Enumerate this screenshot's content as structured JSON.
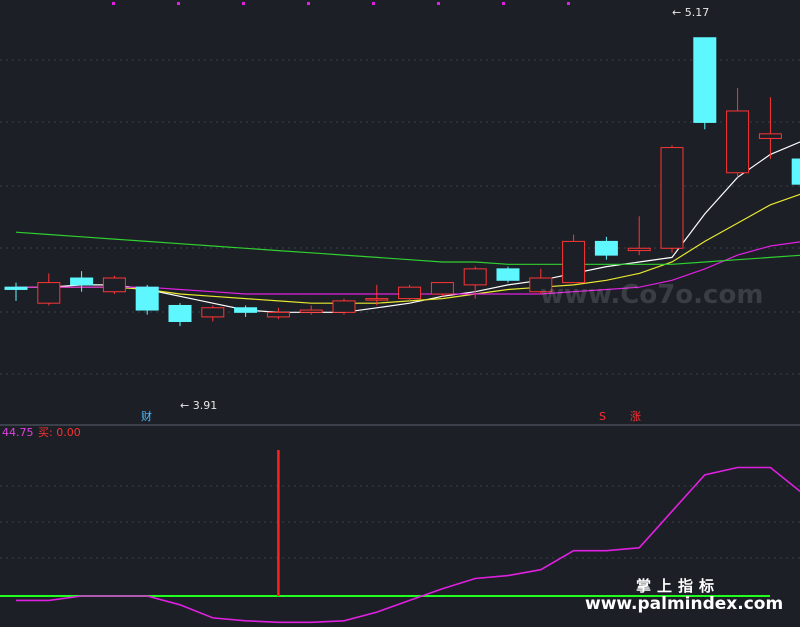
{
  "chart_data": [
    {
      "type": "candlestick",
      "price_range": [
        3.6,
        5.3
      ],
      "candles": [
        {
          "o": 4.08,
          "h": 4.1,
          "l": 4.02,
          "c": 4.07
        },
        {
          "o": 4.01,
          "h": 4.14,
          "l": 4.0,
          "c": 4.1
        },
        {
          "o": 4.12,
          "h": 4.15,
          "l": 4.06,
          "c": 4.09
        },
        {
          "o": 4.06,
          "h": 4.13,
          "l": 4.05,
          "c": 4.12
        },
        {
          "o": 4.08,
          "h": 4.09,
          "l": 3.96,
          "c": 3.98
        },
        {
          "o": 4.0,
          "h": 4.01,
          "l": 3.91,
          "c": 3.93
        },
        {
          "o": 3.95,
          "h": 4.0,
          "l": 3.93,
          "c": 3.99
        },
        {
          "o": 3.99,
          "h": 4.0,
          "l": 3.95,
          "c": 3.97
        },
        {
          "o": 3.95,
          "h": 3.99,
          "l": 3.94,
          "c": 3.97
        },
        {
          "o": 3.97,
          "h": 4.0,
          "l": 3.96,
          "c": 3.98
        },
        {
          "o": 3.97,
          "h": 4.03,
          "l": 3.96,
          "c": 4.02
        },
        {
          "o": 4.03,
          "h": 4.09,
          "l": 4.0,
          "c": 4.03
        },
        {
          "o": 4.03,
          "h": 4.09,
          "l": 4.02,
          "c": 4.08
        },
        {
          "o": 4.05,
          "h": 4.1,
          "l": 4.04,
          "c": 4.1
        },
        {
          "o": 4.09,
          "h": 4.17,
          "l": 4.03,
          "c": 4.16
        },
        {
          "o": 4.16,
          "h": 4.17,
          "l": 4.1,
          "c": 4.11
        },
        {
          "o": 4.06,
          "h": 4.16,
          "l": 4.05,
          "c": 4.12
        },
        {
          "o": 4.1,
          "h": 4.31,
          "l": 4.1,
          "c": 4.28
        },
        {
          "o": 4.28,
          "h": 4.3,
          "l": 4.2,
          "c": 4.22
        },
        {
          "o": 4.24,
          "h": 4.39,
          "l": 4.22,
          "c": 4.25
        },
        {
          "o": 4.25,
          "h": 4.7,
          "l": 4.23,
          "c": 4.69
        },
        {
          "o": 5.17,
          "h": 5.17,
          "l": 4.77,
          "c": 4.8
        },
        {
          "o": 4.58,
          "h": 4.95,
          "l": 4.56,
          "c": 4.85
        },
        {
          "o": 4.73,
          "h": 4.91,
          "l": 4.64,
          "c": 4.75
        },
        {
          "o": 4.64,
          "h": 4.67,
          "l": 4.52,
          "c": 4.53
        }
      ],
      "ma_lines": [
        {
          "name": "MA-white",
          "color": "#ffffff",
          "values": [
            4.08,
            4.08,
            4.09,
            4.09,
            4.07,
            4.04,
            4.01,
            3.98,
            3.97,
            3.97,
            3.97,
            3.99,
            4.01,
            4.04,
            4.06,
            4.09,
            4.11,
            4.14,
            4.17,
            4.19,
            4.21,
            4.4,
            4.56,
            4.66,
            4.72
          ]
        },
        {
          "name": "MA-yellow",
          "color": "#e8e830",
          "values": [
            4.08,
            4.08,
            4.08,
            4.08,
            4.07,
            4.05,
            4.04,
            4.03,
            4.02,
            4.01,
            4.01,
            4.01,
            4.02,
            4.03,
            4.05,
            4.07,
            4.08,
            4.09,
            4.11,
            4.14,
            4.19,
            4.28,
            4.36,
            4.44,
            4.49
          ]
        },
        {
          "name": "MA-magenta",
          "color": "#e020e0",
          "values": [
            4.08,
            4.08,
            4.08,
            4.08,
            4.08,
            4.07,
            4.06,
            4.05,
            4.05,
            4.05,
            4.05,
            4.05,
            4.05,
            4.05,
            4.05,
            4.05,
            4.05,
            4.06,
            4.07,
            4.08,
            4.11,
            4.16,
            4.22,
            4.26,
            4.28
          ]
        },
        {
          "name": "MA-green",
          "color": "#30d030",
          "values": [
            4.32,
            4.31,
            4.3,
            4.29,
            4.28,
            4.27,
            4.26,
            4.25,
            4.24,
            4.23,
            4.22,
            4.21,
            4.2,
            4.19,
            4.19,
            4.18,
            4.18,
            4.18,
            4.18,
            4.18,
            4.18,
            4.19,
            4.2,
            4.21,
            4.22
          ]
        }
      ],
      "high_label": "5.17",
      "low_label": "3.91",
      "markers": {
        "cai": "财",
        "s": "S",
        "zhang": "涨"
      }
    },
    {
      "type": "line",
      "indicator_value": "44.75",
      "buy_label": "买: 0.00",
      "y_range": [
        0,
        100
      ],
      "baseline": 0,
      "spike_index": 8,
      "spike_value": 100,
      "values": [
        -3,
        -3,
        0,
        0,
        0,
        -6,
        -15,
        -17,
        -18,
        -18,
        -17,
        -11,
        -3,
        5,
        12,
        14,
        18,
        31,
        31,
        33,
        58,
        83,
        88,
        88,
        70
      ]
    }
  ],
  "colors": {
    "background": "#1c1f26",
    "up": "#ff3535",
    "down": "#5ff7ff"
  },
  "watermarks": {
    "top": "www.Co7o.com",
    "bottom_cn": "掌上指标",
    "bottom_url": "www.palmindex.com"
  }
}
